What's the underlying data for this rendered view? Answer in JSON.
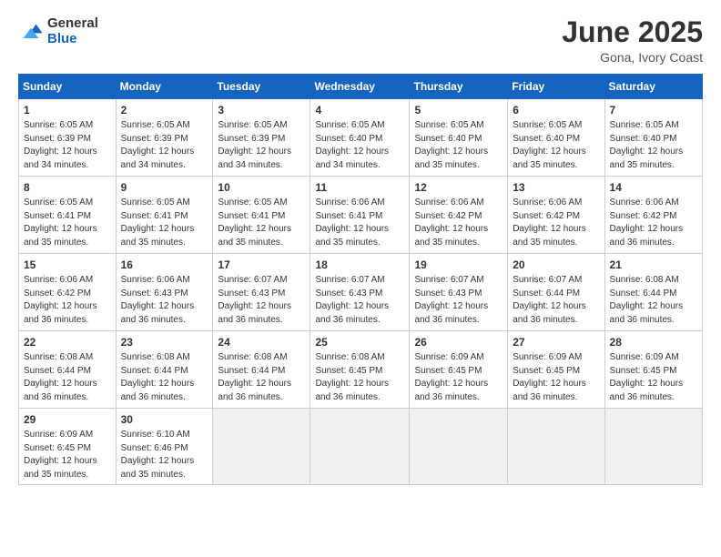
{
  "logo": {
    "general": "General",
    "blue": "Blue"
  },
  "title": "June 2025",
  "location": "Gona, Ivory Coast",
  "days_of_week": [
    "Sunday",
    "Monday",
    "Tuesday",
    "Wednesday",
    "Thursday",
    "Friday",
    "Saturday"
  ],
  "weeks": [
    [
      {
        "day": "1",
        "sunrise": "6:05 AM",
        "sunset": "6:39 PM",
        "daylight": "12 hours and 34 minutes."
      },
      {
        "day": "2",
        "sunrise": "6:05 AM",
        "sunset": "6:39 PM",
        "daylight": "12 hours and 34 minutes."
      },
      {
        "day": "3",
        "sunrise": "6:05 AM",
        "sunset": "6:39 PM",
        "daylight": "12 hours and 34 minutes."
      },
      {
        "day": "4",
        "sunrise": "6:05 AM",
        "sunset": "6:40 PM",
        "daylight": "12 hours and 34 minutes."
      },
      {
        "day": "5",
        "sunrise": "6:05 AM",
        "sunset": "6:40 PM",
        "daylight": "12 hours and 35 minutes."
      },
      {
        "day": "6",
        "sunrise": "6:05 AM",
        "sunset": "6:40 PM",
        "daylight": "12 hours and 35 minutes."
      },
      {
        "day": "7",
        "sunrise": "6:05 AM",
        "sunset": "6:40 PM",
        "daylight": "12 hours and 35 minutes."
      }
    ],
    [
      {
        "day": "8",
        "sunrise": "6:05 AM",
        "sunset": "6:41 PM",
        "daylight": "12 hours and 35 minutes."
      },
      {
        "day": "9",
        "sunrise": "6:05 AM",
        "sunset": "6:41 PM",
        "daylight": "12 hours and 35 minutes."
      },
      {
        "day": "10",
        "sunrise": "6:05 AM",
        "sunset": "6:41 PM",
        "daylight": "12 hours and 35 minutes."
      },
      {
        "day": "11",
        "sunrise": "6:06 AM",
        "sunset": "6:41 PM",
        "daylight": "12 hours and 35 minutes."
      },
      {
        "day": "12",
        "sunrise": "6:06 AM",
        "sunset": "6:42 PM",
        "daylight": "12 hours and 35 minutes."
      },
      {
        "day": "13",
        "sunrise": "6:06 AM",
        "sunset": "6:42 PM",
        "daylight": "12 hours and 35 minutes."
      },
      {
        "day": "14",
        "sunrise": "6:06 AM",
        "sunset": "6:42 PM",
        "daylight": "12 hours and 36 minutes."
      }
    ],
    [
      {
        "day": "15",
        "sunrise": "6:06 AM",
        "sunset": "6:42 PM",
        "daylight": "12 hours and 36 minutes."
      },
      {
        "day": "16",
        "sunrise": "6:06 AM",
        "sunset": "6:43 PM",
        "daylight": "12 hours and 36 minutes."
      },
      {
        "day": "17",
        "sunrise": "6:07 AM",
        "sunset": "6:43 PM",
        "daylight": "12 hours and 36 minutes."
      },
      {
        "day": "18",
        "sunrise": "6:07 AM",
        "sunset": "6:43 PM",
        "daylight": "12 hours and 36 minutes."
      },
      {
        "day": "19",
        "sunrise": "6:07 AM",
        "sunset": "6:43 PM",
        "daylight": "12 hours and 36 minutes."
      },
      {
        "day": "20",
        "sunrise": "6:07 AM",
        "sunset": "6:44 PM",
        "daylight": "12 hours and 36 minutes."
      },
      {
        "day": "21",
        "sunrise": "6:08 AM",
        "sunset": "6:44 PM",
        "daylight": "12 hours and 36 minutes."
      }
    ],
    [
      {
        "day": "22",
        "sunrise": "6:08 AM",
        "sunset": "6:44 PM",
        "daylight": "12 hours and 36 minutes."
      },
      {
        "day": "23",
        "sunrise": "6:08 AM",
        "sunset": "6:44 PM",
        "daylight": "12 hours and 36 minutes."
      },
      {
        "day": "24",
        "sunrise": "6:08 AM",
        "sunset": "6:44 PM",
        "daylight": "12 hours and 36 minutes."
      },
      {
        "day": "25",
        "sunrise": "6:08 AM",
        "sunset": "6:45 PM",
        "daylight": "12 hours and 36 minutes."
      },
      {
        "day": "26",
        "sunrise": "6:09 AM",
        "sunset": "6:45 PM",
        "daylight": "12 hours and 36 minutes."
      },
      {
        "day": "27",
        "sunrise": "6:09 AM",
        "sunset": "6:45 PM",
        "daylight": "12 hours and 36 minutes."
      },
      {
        "day": "28",
        "sunrise": "6:09 AM",
        "sunset": "6:45 PM",
        "daylight": "12 hours and 36 minutes."
      }
    ],
    [
      {
        "day": "29",
        "sunrise": "6:09 AM",
        "sunset": "6:45 PM",
        "daylight": "12 hours and 35 minutes."
      },
      {
        "day": "30",
        "sunrise": "6:10 AM",
        "sunset": "6:46 PM",
        "daylight": "12 hours and 35 minutes."
      },
      null,
      null,
      null,
      null,
      null
    ]
  ],
  "labels": {
    "sunrise": "Sunrise:",
    "sunset": "Sunset:",
    "daylight": "Daylight:"
  }
}
